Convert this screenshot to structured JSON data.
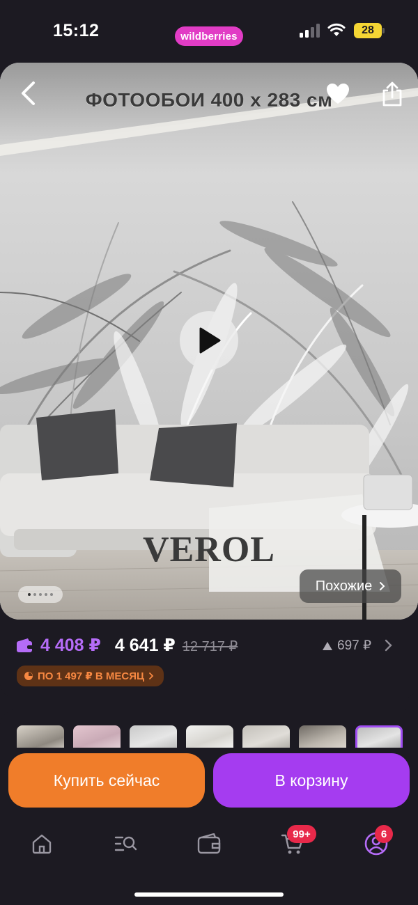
{
  "status_bar": {
    "time": "15:12",
    "app_name": "wildberries",
    "battery": "28"
  },
  "product": {
    "image_title": "ФОТООБОИ 400 x 283 см",
    "brand": "VEROL",
    "similar_label": "Похожие",
    "pager": {
      "total": 5,
      "active": 1
    }
  },
  "price": {
    "wallet_price": "4 408 ₽",
    "current_price": "4 641 ₽",
    "old_price": "12 717 ₽",
    "rating_change": "697 ₽",
    "installment": "ПО 1 497 ₽ В МЕСЯЦ"
  },
  "actions": {
    "buy_now": "Купить сейчас",
    "to_cart": "В корзину"
  },
  "tabbar": {
    "cart_badge": "99+",
    "profile_badge": "6"
  },
  "colors": {
    "background": "#1c1a22",
    "brand_pink": "#e13cc5",
    "wallet_purple": "#b56cf7",
    "buy_orange": "#f07d2a",
    "cart_purple": "#a53cf0",
    "badge_red": "#e8294a"
  },
  "icons": [
    "back-arrow-icon",
    "heart-icon",
    "share-icon",
    "play-icon",
    "wallet-icon",
    "triangle-up-icon",
    "chevron-right-icon",
    "installment-icon",
    "home-icon",
    "catalog-search-icon",
    "wallet-tab-icon",
    "cart-icon",
    "profile-icon"
  ]
}
